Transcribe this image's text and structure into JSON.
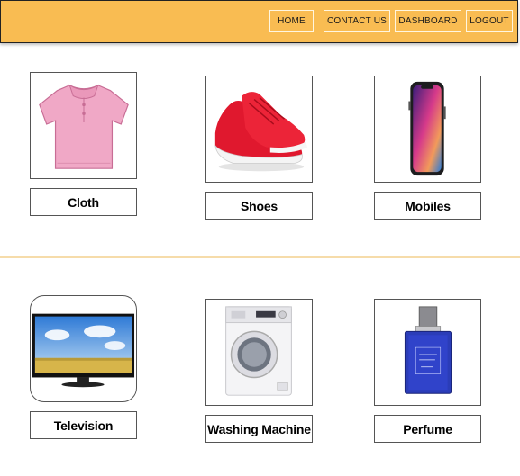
{
  "nav": {
    "home": "HOME",
    "contact": "CONTACT US",
    "dashboard": "DASHBOARD",
    "logout": "LOGOUT"
  },
  "categories": [
    {
      "label": "Cloth",
      "icon": "shirt-icon"
    },
    {
      "label": "Shoes",
      "icon": "sneaker-icon"
    },
    {
      "label": "Mobiles",
      "icon": "smartphone-icon"
    },
    {
      "label": "Television",
      "icon": "television-icon"
    },
    {
      "label": "Washing Machine",
      "icon": "washing-machine-icon"
    },
    {
      "label": "Perfume",
      "icon": "perfume-bottle-icon"
    }
  ],
  "colors": {
    "navbar": "#f9bc52",
    "divider": "#f6dcaa"
  }
}
